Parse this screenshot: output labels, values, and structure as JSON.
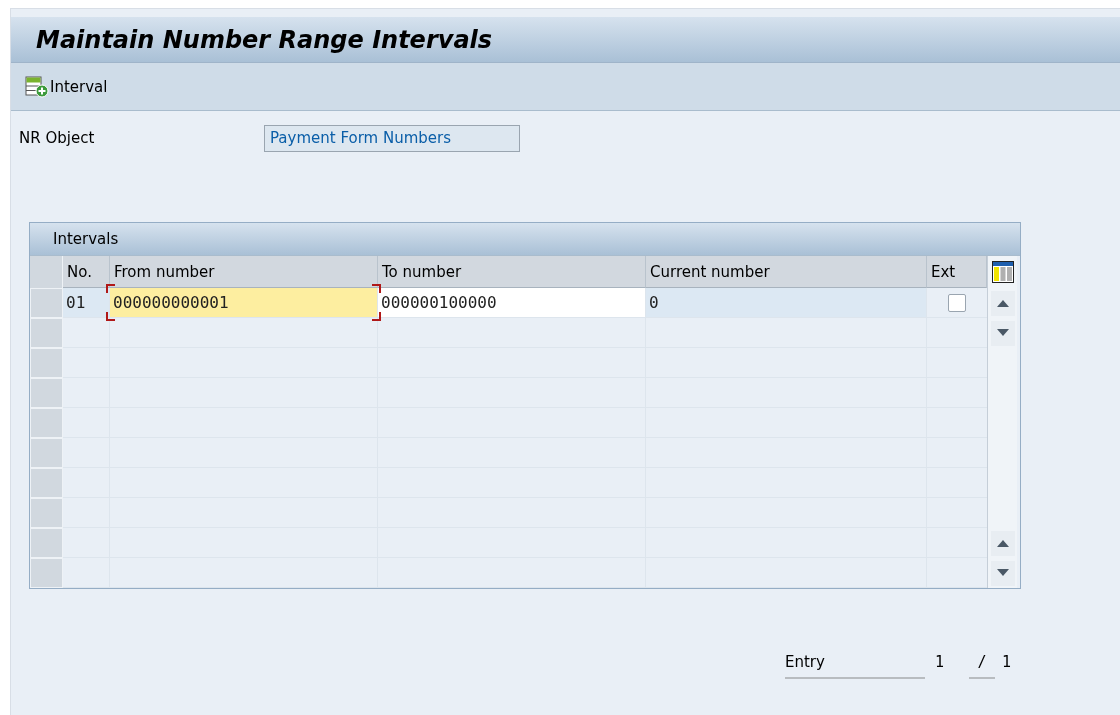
{
  "window": {
    "title": "Maintain Number Range Intervals"
  },
  "toolbar": {
    "buttons": [
      {
        "label": "Interval"
      }
    ]
  },
  "nr_object": {
    "label": "NR Object",
    "value": "Payment Form Numbers"
  },
  "table": {
    "title": "Intervals",
    "columns": [
      "No.",
      "From number",
      "To number",
      "Current number",
      "Ext"
    ],
    "rows": [
      {
        "cells": [
          {
            "kind": "text",
            "value": "01",
            "focused": false,
            "editable": false
          },
          {
            "kind": "text",
            "value": "000000000001",
            "focused": true,
            "editable": true
          },
          {
            "kind": "text",
            "value": "000000100000",
            "focused": false,
            "editable": true
          },
          {
            "kind": "text",
            "value": "0",
            "focused": false,
            "editable": false
          },
          {
            "kind": "checkbox",
            "checked": false
          }
        ]
      }
    ]
  },
  "entry": {
    "label": "Entry",
    "current": "1",
    "separator": "/",
    "total": "1"
  }
}
